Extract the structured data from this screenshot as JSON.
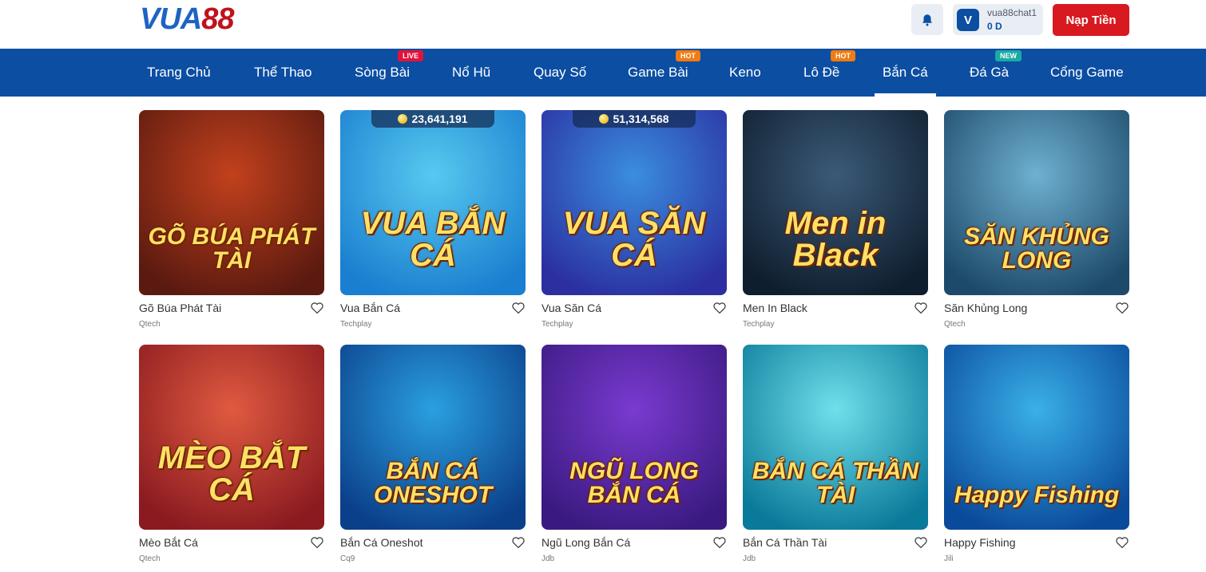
{
  "header": {
    "logo_main": "VUA",
    "logo_num": "88",
    "user": {
      "avatar_letter": "V",
      "username": "vua88chat1",
      "balance": "0 D"
    },
    "deposit_label": "Nạp Tiền"
  },
  "nav": [
    {
      "label": "Trang Chủ"
    },
    {
      "label": "Thể Thao"
    },
    {
      "label": "Sòng Bài",
      "badge": "LIVE"
    },
    {
      "label": "Nổ Hũ"
    },
    {
      "label": "Quay Số"
    },
    {
      "label": "Game Bài",
      "badge": "HOT"
    },
    {
      "label": "Keno"
    },
    {
      "label": "Lô Đề",
      "badge": "HOT"
    },
    {
      "label": "Bắn Cá",
      "active": true
    },
    {
      "label": "Đá Gà",
      "badge": "NEW"
    },
    {
      "label": "Cổng Game"
    }
  ],
  "games": [
    {
      "name": "Gõ Búa Phát Tài",
      "provider": "Qtech",
      "art_text": "GÕ BÚA PHÁT TÀI",
      "colors": [
        "#5b1a10",
        "#c2411d"
      ]
    },
    {
      "name": "Vua Bắn Cá",
      "provider": "Techplay",
      "art_text": "VUA BẮN CÁ",
      "jackpot": "23,641,191",
      "colors": [
        "#1a7fd0",
        "#57c9ef"
      ]
    },
    {
      "name": "Vua Săn Cá",
      "provider": "Techplay",
      "art_text": "VUA SĂN CÁ",
      "jackpot": "51,314,568",
      "colors": [
        "#2b2fa0",
        "#3a8ee0"
      ]
    },
    {
      "name": "Men In Black",
      "provider": "Techplay",
      "art_text": "Men in Black",
      "colors": [
        "#0f1e2e",
        "#3b5a78"
      ]
    },
    {
      "name": "Săn Khủng Long",
      "provider": "Qtech",
      "art_text": "SĂN KHỦNG LONG",
      "colors": [
        "#1d4a6a",
        "#6fb0d0"
      ]
    },
    {
      "name": "Mèo Bắt Cá",
      "provider": "Qtech",
      "art_text": "MÈO BẮT CÁ",
      "colors": [
        "#8a1a20",
        "#e05a40"
      ]
    },
    {
      "name": "Bắn Cá Oneshot",
      "provider": "Cq9",
      "art_text": "BẮN CÁ ONESHOT",
      "colors": [
        "#0b3f8a",
        "#2aa0e0"
      ]
    },
    {
      "name": "Ngũ Long Bắn Cá",
      "provider": "Jdb",
      "art_text": "NGŨ LONG BẮN CÁ",
      "colors": [
        "#3a1a80",
        "#7a3ad0"
      ]
    },
    {
      "name": "Bắn Cá Thần Tài",
      "provider": "Jdb",
      "art_text": "BẮN CÁ THẦN TÀI",
      "colors": [
        "#0a7a9a",
        "#6fe0ea"
      ]
    },
    {
      "name": "Happy Fishing",
      "provider": "Jili",
      "art_text": "Happy Fishing",
      "colors": [
        "#0a4a9a",
        "#3ab0e8"
      ]
    }
  ]
}
